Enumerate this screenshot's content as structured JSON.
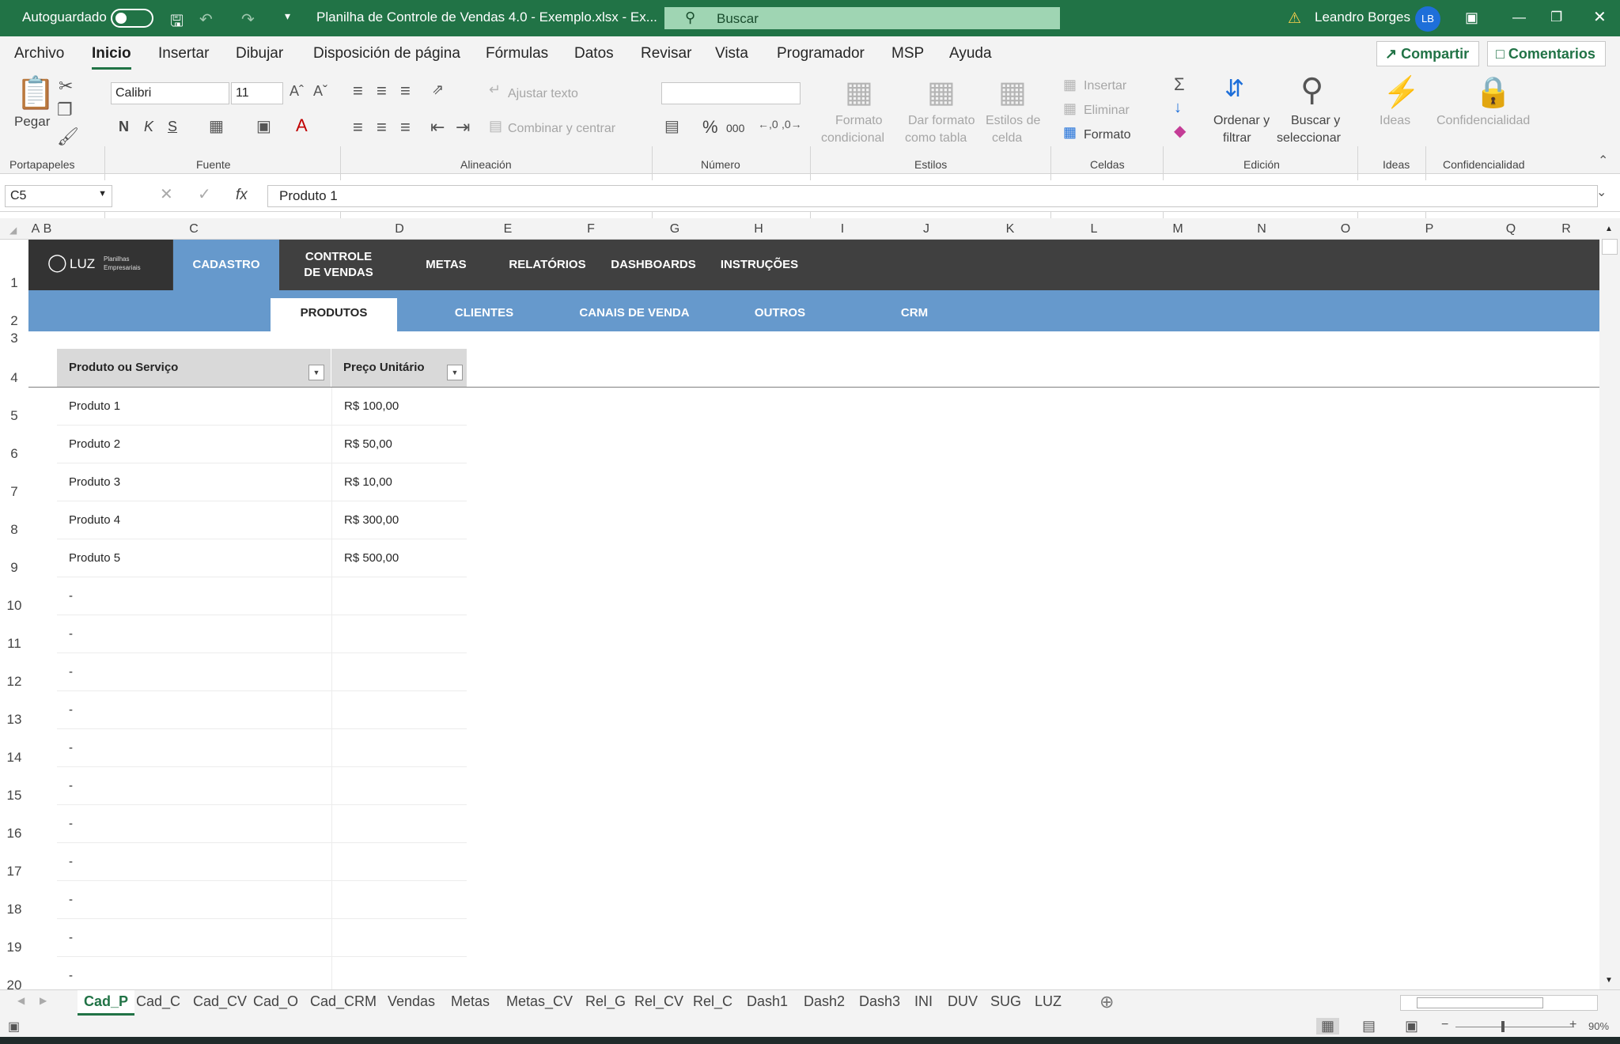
{
  "titlebar": {
    "autosave_label": "Autoguardado",
    "file_title": "Planilha de Controle de Vendas 4.0 - Exemplo.xlsx  -  Ex...",
    "search_placeholder": "Buscar",
    "user_name": "Leandro Borges",
    "user_initials": "LB"
  },
  "menu": {
    "items": [
      "Archivo",
      "Inicio",
      "Insertar",
      "Dibujar",
      "Disposición de página",
      "Fórmulas",
      "Datos",
      "Revisar",
      "Vista",
      "Programador",
      "MSP",
      "Ayuda"
    ],
    "share": "Compartir",
    "comments": "Comentarios"
  },
  "ribbon": {
    "paste": "Pegar",
    "font_name": "Calibri",
    "font_size": "11",
    "bold": "N",
    "italic": "K",
    "underline": "S",
    "wrap_text": "Ajustar texto",
    "merge_center": "Combinar y centrar",
    "percent": "%",
    "thousands": "000",
    "cond_format_1": "Formato",
    "cond_format_2": "condicional",
    "table_format_1": "Dar formato",
    "table_format_2": "como tabla",
    "cell_styles_1": "Estilos de",
    "cell_styles_2": "celda",
    "insert": "Insertar",
    "delete": "Eliminar",
    "format": "Formato",
    "sort_1": "Ordenar y",
    "sort_2": "filtrar",
    "find_1": "Buscar y",
    "find_2": "seleccionar",
    "ideas": "Ideas",
    "confidentiality": "Confidencialidad",
    "groups": {
      "clipboard": "Portapapeles",
      "font": "Fuente",
      "alignment": "Alineación",
      "number": "Número",
      "styles": "Estilos",
      "cells": "Celdas",
      "editing": "Edición",
      "ideas": "Ideas",
      "confidentiality": "Confidencialidad"
    }
  },
  "formula_bar": {
    "cell_ref": "C5",
    "fx": "fx",
    "value": "Produto 1"
  },
  "columns": [
    "A",
    "B",
    "C",
    "D",
    "E",
    "F",
    "G",
    "H",
    "I",
    "J",
    "K",
    "L",
    "M",
    "N",
    "O",
    "P",
    "Q",
    "R"
  ],
  "rows": [
    "1",
    "2",
    "3",
    "4",
    "5",
    "6",
    "7",
    "8",
    "9",
    "10",
    "11",
    "12",
    "13",
    "14",
    "15",
    "16",
    "17",
    "18",
    "19",
    "20"
  ],
  "nav": {
    "logo": "LUZ",
    "logo_sub_1": "Planilhas",
    "logo_sub_2": "Empresariais",
    "items": [
      "CADASTRO",
      "CONTROLE",
      "DE VENDAS",
      "METAS",
      "RELATÓRIOS",
      "DASHBOARDS",
      "INSTRUÇÕES"
    ],
    "sub_items": [
      "PRODUTOS",
      "CLIENTES",
      "CANAIS DE VENDA",
      "OUTROS",
      "CRM"
    ]
  },
  "table": {
    "headers": [
      "Produto ou Serviço",
      "Preço Unitário"
    ],
    "rows": [
      [
        "Produto 1",
        "R$ 100,00"
      ],
      [
        "Produto 2",
        "R$ 50,00"
      ],
      [
        "Produto 3",
        "R$ 10,00"
      ],
      [
        "Produto 4",
        "R$ 300,00"
      ],
      [
        "Produto 5",
        "R$ 500,00"
      ],
      [
        "-",
        ""
      ],
      [
        "-",
        ""
      ],
      [
        "-",
        ""
      ],
      [
        "-",
        ""
      ],
      [
        "-",
        ""
      ],
      [
        "-",
        ""
      ],
      [
        "-",
        ""
      ],
      [
        "-",
        ""
      ],
      [
        "-",
        ""
      ],
      [
        "-",
        ""
      ],
      [
        "-",
        ""
      ]
    ]
  },
  "sheet_tabs": [
    "Cad_P",
    "Cad_C",
    "Cad_CV",
    "Cad_O",
    "Cad_CRM",
    "Vendas",
    "Metas",
    "Metas_CV",
    "Rel_G",
    "Rel_CV",
    "Rel_C",
    "Dash1",
    "Dash2",
    "Dash3",
    "INI",
    "DUV",
    "SUG",
    "LUZ"
  ],
  "status": {
    "zoom": "90%"
  },
  "colors": {
    "excel_green": "#217346",
    "nav_dark": "#404040",
    "nav_blue": "#6699cc"
  }
}
